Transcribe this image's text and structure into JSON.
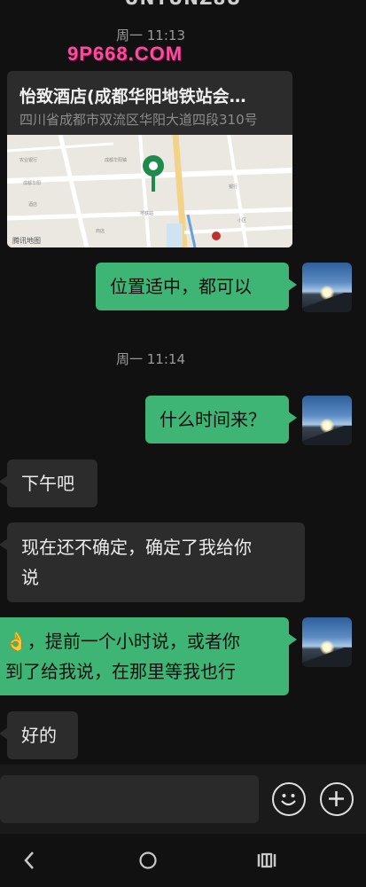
{
  "header": {
    "partial_title": "UNTUNZ8U"
  },
  "watermark": "9P668.COM",
  "messages": [
    {
      "type": "time",
      "text": "周一 11:13"
    },
    {
      "type": "location",
      "side": "in",
      "title": "怡致酒店(成都华阳地铁站会…",
      "address": "四川省成都市双流区华阳大道四段310号",
      "map_credit": "腾讯地图",
      "pin_color": "#1e8a4c"
    },
    {
      "type": "text",
      "side": "out",
      "text": "位置适中，都可以"
    },
    {
      "type": "time",
      "text": "周一 11:14"
    },
    {
      "type": "text",
      "side": "out",
      "text": "什么时间来？"
    },
    {
      "type": "text",
      "side": "in",
      "text": "下午吧"
    },
    {
      "type": "text",
      "side": "in",
      "lines": [
        "现在还不确定，确定了我给你",
        "说"
      ]
    },
    {
      "type": "text",
      "side": "out",
      "emoji": "👌",
      "lines": [
        "，提前一个小时说，或者你",
        "到了给我说，在那里等我也行"
      ]
    },
    {
      "type": "text",
      "side": "in",
      "text": "好的"
    }
  ],
  "input_bar": {
    "emoji_icon": "smiley-icon",
    "plus_icon": "plus-icon"
  },
  "nav": {
    "back": "‹",
    "home": "○",
    "recent": "|||"
  },
  "colors": {
    "bubble_out": "#3eb575",
    "bubble_in": "#2c2c2c",
    "background": "#111111"
  }
}
